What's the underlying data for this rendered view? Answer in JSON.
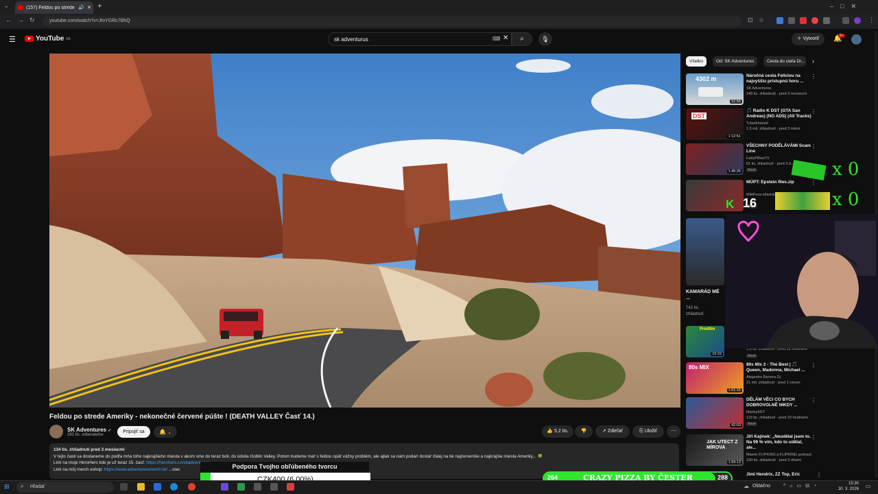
{
  "browser": {
    "tab_title": "(157) Feldou po strede Am...",
    "url": "youtube.com/watch?v=JtoYGRc7BhQ",
    "new_tab": "+"
  },
  "header": {
    "logo_text": "YouTube",
    "logo_country": "SK",
    "search_value": "sk adventurus",
    "create_label": "Vytvoriť",
    "notif_count": "9+"
  },
  "video": {
    "title": "Feldou po strede Ameriky - nekonečné červené púšte ! (DEATH VALLEY Časť 14.)",
    "channel_name": "SK Adventures",
    "subscribers": "291 tis. odberateľov",
    "join_label": "Pripojiť sa",
    "likes": "5,2 tis.",
    "share_label": "Zdieľať",
    "save_label": "Uložiť",
    "description": {
      "meta": "134 tis. zhliadnutí  pred 3 mesiacmi",
      "line1": "V tejto časti sa dostaneme do podľa mňa toho najkrajšieho miesta v akom sme do teraz boli, do údolia Goblin Valley. Potom budeme mať s feldou opäť vážny problém, ale ajtak sa nám podarí dostať ďalej na tie najčervenšie a najkrajšie miesta Ameriky... 🍀",
      "line2_text": "Link na moje HeroHero kde je už teraz 15. časť: ",
      "line2_link": "https://herohero.co/skadventures",
      "line3_text": "Link na môj merch eshop: ",
      "line3_link": "https://www.adventuresmerch.sk/",
      "more": "...viac"
    }
  },
  "chips": [
    "Všetko",
    "Od: SK Adventures",
    "Cesta do cieľa Dr..."
  ],
  "recommendations": [
    {
      "title": "Náročná cesta Feliciou na najvyššiu prístupnú horu ...",
      "channel": "SK Adventures",
      "meta": "148 tis. zhliadnutí · pred 3 mesiacmi",
      "duration": "52:56",
      "thumb_text": "4302 m",
      "badge": ""
    },
    {
      "title": "🎵 Radio K DST (GTA San Andreas) (NO ADS) (All Tracks)",
      "channel": "Tutankhamal",
      "meta": "1,5 mil. zhliadnutí · pred 3 rokmi",
      "duration": "1:12:51",
      "thumb_text": "DST",
      "badge": ""
    },
    {
      "title": "VŠECHNY PODĚLÁVÁMI Scam Line",
      "channel": "FattyPillowTV",
      "meta": "61 tis. zhliadnutí · pred 3 d...",
      "duration": "1:45:26",
      "thumb_text": "",
      "badge": "Nové"
    },
    {
      "title": "MÚPT: Epstein files.zip",
      "channel": "MikiFoxa úžasná príl...",
      "meta": "",
      "duration": "",
      "thumb_text": "",
      "badge": "Nové"
    },
    {
      "title": "",
      "channel": "",
      "meta": "1,6 tis. zhliadnutí · pred 22 hodinami",
      "duration": "10:22",
      "thumb_text": "Predtím",
      "badge": "Nové"
    },
    {
      "title": "80s Mix 2 - The Best | 🎵 Queen, Madonna, Michael ...",
      "channel": "Alejandro Barrera Dj",
      "meta": "21 mil. zhliadnutí · pred 1 rokom",
      "duration": "1:01:15",
      "thumb_text": "80s MIX",
      "badge": ""
    },
    {
      "title": "DĚLÁM VĚCI CO BYCH DOBROVOLNĚ NIKDY ...",
      "channel": "MarleyKKT",
      "meta": "119 tis. zhliadnutí · pred 23 hodinami",
      "duration": "42:03",
      "thumb_text": "",
      "badge": "Nové"
    },
    {
      "title": "Jiří Kajínek: „Neudělal jsem to. Na 99 % vím, kdo to udělal, ale...",
      "channel": "Maxim FLIPKING a FLIPKING podcast",
      "meta": "100 tis. zhliadnutí · pred 3 dňami",
      "duration": "1:59:13",
      "thumb_text": "JAK UTECT Z MÍROVA",
      "badge": ""
    },
    {
      "title": "Jimi Hendrix, ZZ Top, Eric",
      "channel": "",
      "meta": "",
      "duration": "",
      "thumb_text": "",
      "badge": ""
    }
  ],
  "tall_rec": {
    "title": "KAMARÁD MÉ ...",
    "meta1": "742 tis.",
    "meta2": "zhliadnutí"
  },
  "overlay": {
    "counter1": "x 0",
    "counter2": "x 0",
    "k_count": "16",
    "support_text": "Podpora Tvojho obľúbeného tvorcu",
    "goal_text": "CZK400 (6.00%)",
    "goal_progress": 0.06,
    "pizza_left": "264",
    "pizza_title": "CRAZY PIZZA BY ČESTER",
    "pizza_right": "288",
    "pizza_progress": 0.917
  },
  "taskbar": {
    "search_placeholder": "Hľadať",
    "weather": "Oblačno",
    "time": "15:30",
    "date": "30. 3. 2026"
  },
  "colors": {
    "accent_green": "#2ee62e",
    "yt_red": "#ff0000",
    "link_blue": "#3ea6ff"
  }
}
